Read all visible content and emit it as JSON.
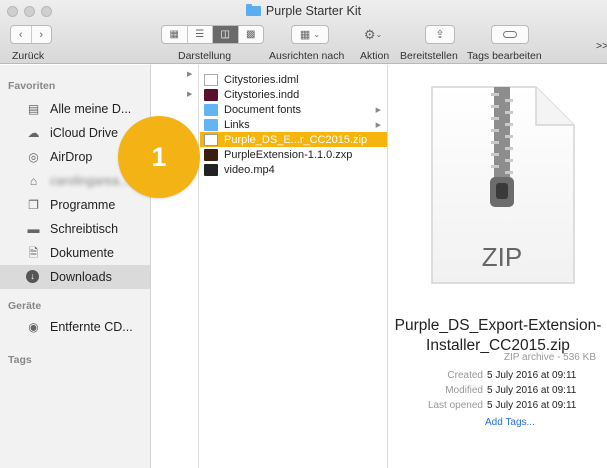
{
  "window": {
    "title": "Purple Starter Kit"
  },
  "toolbar": {
    "back_label": "Zurück",
    "view_label": "Darstellung",
    "arrange_label": "Ausrichten nach",
    "action_label": "Aktion",
    "share_label": "Bereitstellen",
    "tags_label": "Tags bearbeiten",
    "more_label": ">>"
  },
  "sidebar": {
    "favorites_heading": "Favoriten",
    "favorites": [
      {
        "label": "Alle meine D...",
        "icon": "all-files-icon"
      },
      {
        "label": "iCloud Drive",
        "icon": "cloud-icon"
      },
      {
        "label": "AirDrop",
        "icon": "airdrop-icon"
      },
      {
        "label": "carolingarea...",
        "icon": "home-icon"
      },
      {
        "label": "Programme",
        "icon": "applications-icon"
      },
      {
        "label": "Schreibtisch",
        "icon": "desktop-icon"
      },
      {
        "label": "Dokumente",
        "icon": "documents-icon"
      },
      {
        "label": "Downloads",
        "icon": "downloads-icon"
      }
    ],
    "devices_heading": "Geräte",
    "devices": [
      {
        "label": "Entfernte CD...",
        "icon": "disc-icon"
      }
    ],
    "tags_heading": "Tags"
  },
  "files": [
    {
      "name": "Citystories.idml",
      "icon": "document-icon",
      "has_children": false
    },
    {
      "name": "Citystories.indd",
      "icon": "indesign-icon",
      "has_children": false
    },
    {
      "name": "Document fonts",
      "icon": "folder-icon",
      "has_children": true
    },
    {
      "name": "Links",
      "icon": "folder-icon",
      "has_children": true
    },
    {
      "name": "Purple_DS_E...r_CC2015.zip",
      "icon": "zip-icon",
      "has_children": false,
      "selected": true
    },
    {
      "name": "PurpleExtension-1.1.0.zxp",
      "icon": "zxp-icon",
      "has_children": false
    },
    {
      "name": "video.mp4",
      "icon": "video-icon",
      "has_children": false
    }
  ],
  "preview": {
    "icon_text": "ZIP",
    "name_line1": "Purple_DS_Export-Extension-",
    "name_line2": "Installer_CC2015.zip",
    "kind": "ZIP archive - 536 KB",
    "created_label": "Created",
    "created_value": "5 July 2016 at 09:11",
    "modified_label": "Modified",
    "modified_value": "5 July 2016 at 09:11",
    "opened_label": "Last opened",
    "opened_value": "5 July 2016 at 09:11",
    "add_tags": "Add Tags..."
  },
  "callout": {
    "number": "1",
    "color": "#f3b315"
  },
  "colors": {
    "selection": "#f6b40d",
    "link": "#2a6ee0"
  }
}
